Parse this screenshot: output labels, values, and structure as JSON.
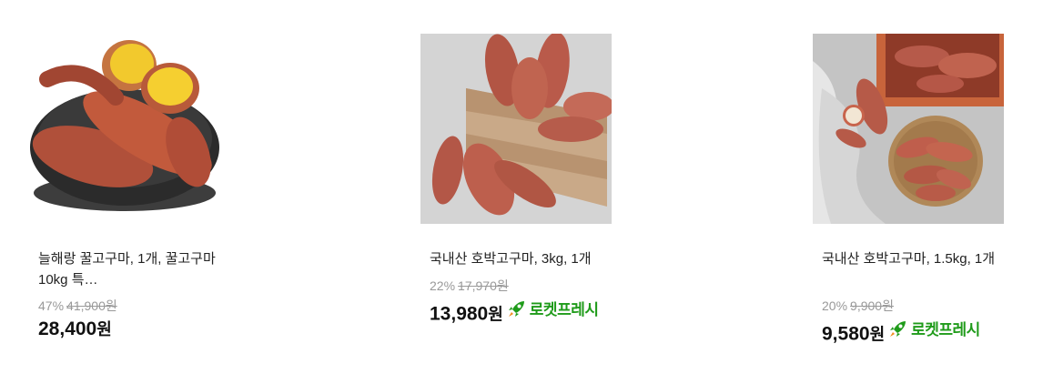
{
  "products": [
    {
      "image_icon": "sweet-potato-bowl-image",
      "title": "늘해랑 꿀고구마, 1개, 꿀고구마 10kg 특…",
      "discount_rate": "47%",
      "original_price": "41,900원",
      "price_number": "28,400",
      "price_unit": "원",
      "badge": ""
    },
    {
      "image_icon": "sweet-potato-crate-image",
      "title": "국내산 호박고구마, 3kg, 1개",
      "discount_rate": "22%",
      "original_price": "17,970원",
      "price_number": "13,980",
      "price_unit": "원",
      "badge": "로켓프레시"
    },
    {
      "image_icon": "sweet-potato-basket-image",
      "title": "국내산 호박고구마, 1.5kg, 1개",
      "discount_rate": "20%",
      "original_price": "9,900원",
      "price_number": "9,580",
      "price_unit": "원",
      "badge": "로켓프레시"
    }
  ],
  "colors": {
    "badge_green": "#1f9b1a",
    "strike_gray": "#999999",
    "price_black": "#111111"
  }
}
